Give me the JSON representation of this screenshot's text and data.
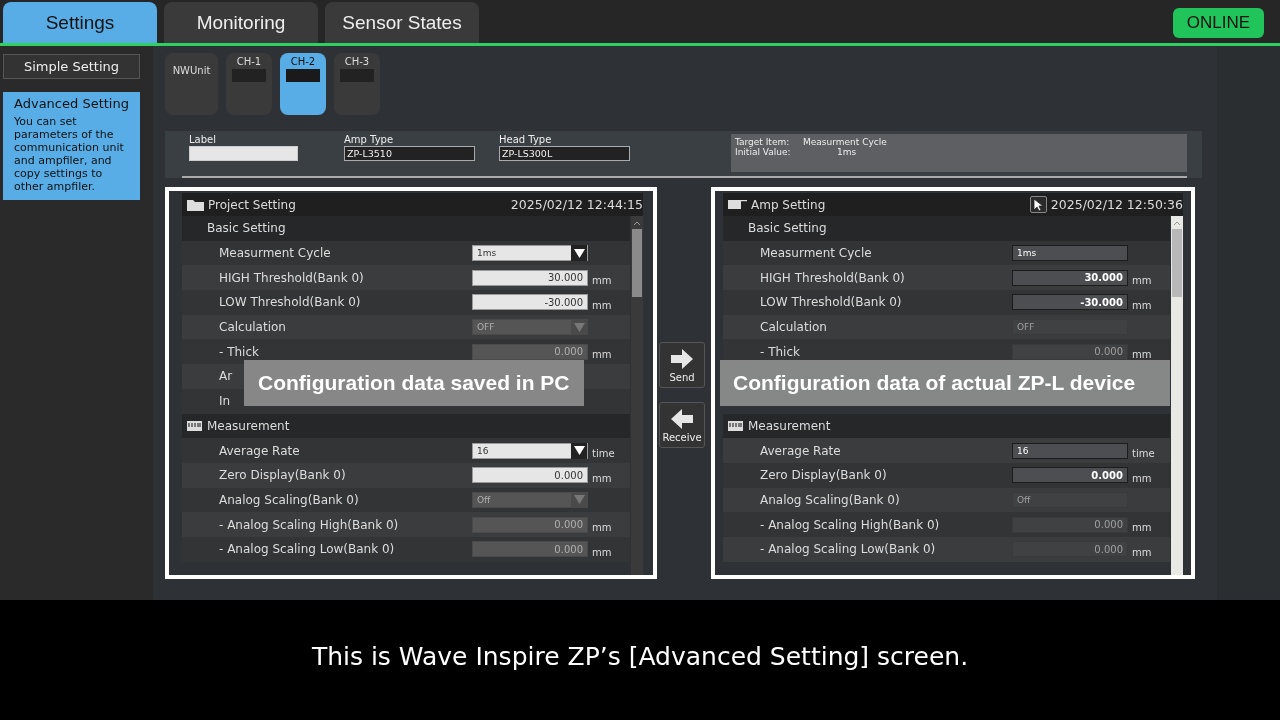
{
  "tabs": [
    {
      "label": "Settings",
      "selected": true
    },
    {
      "label": "Monitoring",
      "selected": false
    },
    {
      "label": "Sensor States",
      "selected": false
    }
  ],
  "status": {
    "label": "ONLINE",
    "online": true
  },
  "sidebar": {
    "items": [
      {
        "label": "Simple Setting",
        "selected": false
      },
      {
        "label": "Advanced Setting",
        "selected": true,
        "description": "You can set parameters of the communication unit and ampfiler, and copy settings to other ampfiler."
      }
    ]
  },
  "units": [
    {
      "label": "NWUnit",
      "kind": "unit",
      "selected": false
    },
    {
      "label": "CH-1",
      "kind": "channel",
      "selected": false
    },
    {
      "label": "CH-2",
      "kind": "channel",
      "selected": true
    },
    {
      "label": "CH-3",
      "kind": "channel",
      "selected": false
    }
  ],
  "info": {
    "fields": [
      {
        "label": "Label",
        "kind": "blank"
      },
      {
        "label": "Amp Type",
        "kind": "text",
        "value": "ZP-L3510"
      },
      {
        "label": "Head Type",
        "kind": "text",
        "value": "ZP-LS300L"
      }
    ],
    "target": [
      {
        "label": "Target Item:",
        "value": "Measurment Cycle"
      },
      {
        "label": "Initial Value:",
        "value": "1ms"
      }
    ]
  },
  "panels": [
    {
      "title": "Project Setting",
      "timestamp": "2025/02/12 12:44:15",
      "editable": true,
      "header_button": false,
      "caption": "Configuration data saved in PC",
      "rows": [
        {
          "kind": "group",
          "label": "Basic Setting"
        },
        {
          "kind": "select",
          "label": "Measurment Cycle",
          "value": "1ms",
          "disabled": false
        },
        {
          "kind": "input",
          "label": "HIGH Threshold(Bank 0)",
          "value": "30.000",
          "unit": "mm",
          "disabled": false
        },
        {
          "kind": "input",
          "label": "LOW Threshold(Bank 0)",
          "value": "-30.000",
          "unit": "mm",
          "disabled": false
        },
        {
          "kind": "select",
          "label": "Calculation",
          "value": "OFF",
          "disabled": true
        },
        {
          "kind": "input",
          "label": "- Thick",
          "value": "0.000",
          "unit": "mm",
          "disabled": true
        },
        {
          "kind": "label",
          "label": "Ar"
        },
        {
          "kind": "label",
          "label": "In"
        },
        {
          "kind": "section",
          "label": "Measurement"
        },
        {
          "kind": "select",
          "label": "Average Rate",
          "value": "16",
          "unit": "time",
          "disabled": false
        },
        {
          "kind": "input",
          "label": "Zero Display(Bank 0)",
          "value": "0.000",
          "unit": "mm",
          "disabled": false
        },
        {
          "kind": "select",
          "label": "Analog Scaling(Bank 0)",
          "value": "Off",
          "disabled": true
        },
        {
          "kind": "input",
          "label": "- Analog Scaling High(Bank 0)",
          "value": "0.000",
          "unit": "mm",
          "disabled": true
        },
        {
          "kind": "input",
          "label": "- Analog Scaling Low(Bank 0)",
          "value": "0.000",
          "unit": "mm",
          "disabled": true
        }
      ]
    },
    {
      "title": "Amp Setting",
      "timestamp": "2025/02/12 12:50:36",
      "editable": false,
      "header_button": true,
      "rows": [
        {
          "kind": "group",
          "label": "Basic Setting"
        },
        {
          "kind": "select",
          "label": "Measurment Cycle",
          "value": "1ms",
          "disabled": false
        },
        {
          "kind": "input",
          "label": "HIGH Threshold(Bank 0)",
          "value": "30.000",
          "unit": "mm",
          "disabled": false
        },
        {
          "kind": "input",
          "label": "LOW Threshold(Bank 0)",
          "value": "-30.000",
          "unit": "mm",
          "disabled": false
        },
        {
          "kind": "select",
          "label": "Calculation",
          "value": "OFF",
          "disabled": true
        },
        {
          "kind": "input",
          "label": "- Thick",
          "value": "0.000",
          "unit": "mm",
          "disabled": true
        },
        {
          "kind": "caption",
          "text": "Configuration data of actual ZP-L device"
        },
        {
          "kind": "section",
          "label": "Measurement"
        },
        {
          "kind": "select",
          "label": "Average Rate",
          "value": "16",
          "unit": "time",
          "disabled": false
        },
        {
          "kind": "input",
          "label": "Zero Display(Bank 0)",
          "value": "0.000",
          "unit": "mm",
          "disabled": false
        },
        {
          "kind": "select",
          "label": "Analog Scaling(Bank 0)",
          "value": "Off",
          "disabled": true
        },
        {
          "kind": "input",
          "label": "- Analog Scaling High(Bank 0)",
          "value": "0.000",
          "unit": "mm",
          "disabled": true
        },
        {
          "kind": "input",
          "label": "- Analog Scaling Low(Bank 0)",
          "value": "0.000",
          "unit": "mm",
          "disabled": true
        }
      ]
    }
  ],
  "transfer_buttons": [
    {
      "label": "Send",
      "kind": "send"
    },
    {
      "label": "Receive",
      "kind": "receive"
    }
  ],
  "subtitle": "This is Wave Inspire ZP’s [Advanced Setting] screen."
}
